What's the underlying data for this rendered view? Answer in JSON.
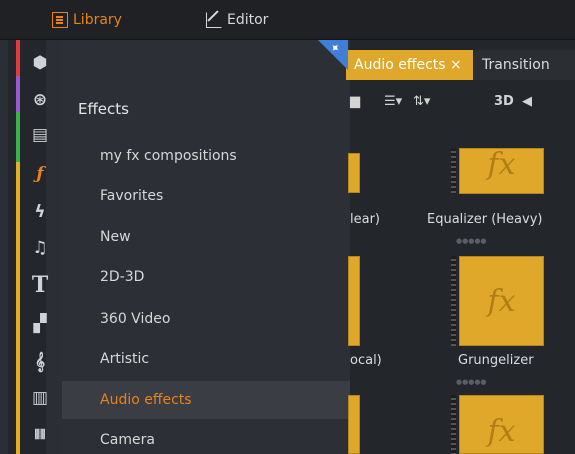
{
  "topbar": {
    "library_label": "Library",
    "editor_label": "Editor"
  },
  "panel": {
    "title": "Effects",
    "items": [
      {
        "label": "my fx compositions",
        "active": false
      },
      {
        "label": "Favorites",
        "active": false
      },
      {
        "label": "New",
        "active": false
      },
      {
        "label": "2D-3D",
        "active": false
      },
      {
        "label": "360 Video",
        "active": false
      },
      {
        "label": "Artistic",
        "active": false
      },
      {
        "label": "Audio effects",
        "active": true
      },
      {
        "label": "Camera",
        "active": false
      }
    ]
  },
  "browser": {
    "tabs": [
      {
        "label": "Audio effects ×"
      },
      {
        "label": "Transition"
      }
    ],
    "toolbar": {
      "view_3d": "3D"
    },
    "captions": {
      "left_1": "lear)",
      "right_1": "Equalizer (Heavy)",
      "left_2": "ocal)",
      "right_2": "Grungelizer"
    },
    "thumb_glyph": "fx"
  },
  "colors": {
    "accent": "#e8821a",
    "thumb": "#e0a82b",
    "rail_stripes": [
      "#e03c3c",
      "#9b59d0",
      "#3a8fd8",
      "#3cb24a",
      "#e0b020"
    ]
  },
  "icons": [
    "box-icon",
    "film-reel-icon",
    "clapper-icon",
    "fx-icon",
    "lightning-icon",
    "music-note-icon",
    "title-icon",
    "montage-icon",
    "clef-icon",
    "piano-icon",
    "waveform-icon"
  ]
}
